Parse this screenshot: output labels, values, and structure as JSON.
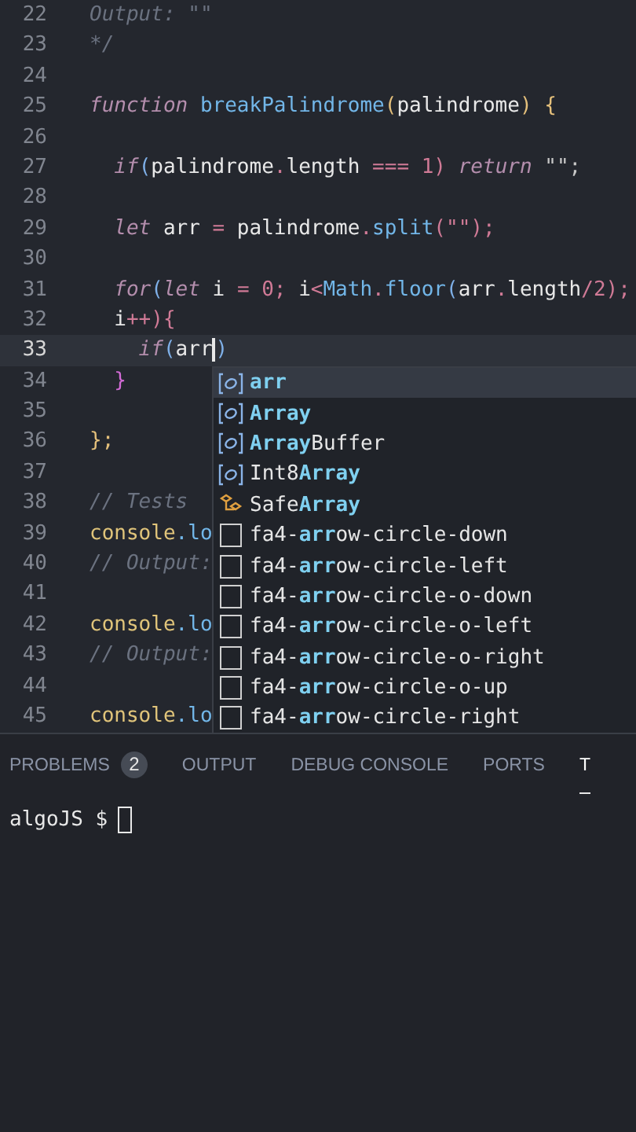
{
  "editor": {
    "lines": [
      {
        "n": "22",
        "current": false,
        "tokens": [
          {
            "t": "Output: \"\"",
            "kind": "comment"
          }
        ]
      },
      {
        "n": "23",
        "current": false,
        "tokens": [
          {
            "t": "*/",
            "kind": "comment"
          }
        ]
      },
      {
        "n": "24",
        "current": false
      },
      {
        "n": "25",
        "current": false,
        "tokens": [
          {
            "t": "function ",
            "kind": "kw"
          },
          {
            "t": "breakPalindrome",
            "kind": "fn"
          },
          {
            "t": "(",
            "kind": "brace"
          },
          {
            "t": "palindrome",
            "kind": "plain"
          },
          {
            "t": ") {",
            "kind": "brace"
          }
        ]
      },
      {
        "n": "26",
        "current": false
      },
      {
        "n": "27",
        "current": false,
        "tokens": [
          {
            "t": "  if",
            "kind": "kw"
          },
          {
            "t": "(",
            "kind": "paren"
          },
          {
            "t": "palindrome",
            "kind": "plain"
          },
          {
            "t": ".",
            "kind": "op"
          },
          {
            "t": "length ",
            "kind": "plain"
          },
          {
            "t": "=== 1)",
            "kind": "op"
          },
          {
            "t": " return",
            "kind": "kw"
          },
          {
            "t": " \"\";",
            "kind": "str"
          }
        ]
      },
      {
        "n": "28",
        "current": false
      },
      {
        "n": "29",
        "current": false,
        "tokens": [
          {
            "t": "  let",
            "kind": "kw"
          },
          {
            "t": " arr ",
            "kind": "plain"
          },
          {
            "t": "=",
            "kind": "op"
          },
          {
            "t": " palindrome",
            "kind": "plain"
          },
          {
            "t": ".",
            "kind": "op"
          },
          {
            "t": "split",
            "kind": "fn"
          },
          {
            "t": "(\"\");",
            "kind": "op"
          }
        ]
      },
      {
        "n": "30",
        "current": false
      },
      {
        "n": "31",
        "current": false,
        "tokens": [
          {
            "t": "  for",
            "kind": "kw"
          },
          {
            "t": "(",
            "kind": "paren"
          },
          {
            "t": "let",
            "kind": "kw"
          },
          {
            "t": " i ",
            "kind": "plain"
          },
          {
            "t": "= 0;",
            "kind": "op"
          },
          {
            "t": " i",
            "kind": "plain"
          },
          {
            "t": "<",
            "kind": "op"
          },
          {
            "t": "Math",
            "kind": "fn"
          },
          {
            "t": ".",
            "kind": "op"
          },
          {
            "t": "floor",
            "kind": "fn"
          },
          {
            "t": "(",
            "kind": "paren"
          },
          {
            "t": "arr",
            "kind": "plain"
          },
          {
            "t": ".",
            "kind": "op"
          },
          {
            "t": "length",
            "kind": "plain"
          },
          {
            "t": "/2);",
            "kind": "op"
          }
        ]
      },
      {
        "n": "32",
        "current": false,
        "tokens": [
          {
            "t": "  i",
            "kind": "plain"
          },
          {
            "t": "++){",
            "kind": "op"
          }
        ]
      },
      {
        "n": "33",
        "current": true,
        "tokens": [
          {
            "t": "    if",
            "kind": "kw"
          },
          {
            "t": "(",
            "kind": "paren"
          },
          {
            "t": "arr",
            "kind": "plain"
          },
          {
            "kind": "cursor"
          },
          {
            "t": ")",
            "kind": "paren"
          }
        ]
      },
      {
        "n": "34",
        "current": false,
        "tokens": [
          {
            "t": "  }",
            "kind": "brace2"
          }
        ]
      },
      {
        "n": "35",
        "current": false
      },
      {
        "n": "36",
        "current": false,
        "tokens": [
          {
            "t": "};",
            "kind": "brace"
          }
        ]
      },
      {
        "n": "37",
        "current": false
      },
      {
        "n": "38",
        "current": false,
        "tokens": [
          {
            "t": "// Tests",
            "kind": "comment"
          }
        ]
      },
      {
        "n": "39",
        "current": false,
        "tokens": [
          {
            "t": "console",
            "kind": "obj"
          },
          {
            "t": ".lo",
            "kind": "fn"
          }
        ]
      },
      {
        "n": "40",
        "current": false,
        "tokens": [
          {
            "t": "// Output:",
            "kind": "comment"
          }
        ]
      },
      {
        "n": "41",
        "current": false
      },
      {
        "n": "42",
        "current": false,
        "tokens": [
          {
            "t": "console",
            "kind": "obj"
          },
          {
            "t": ".lo",
            "kind": "fn"
          }
        ]
      },
      {
        "n": "43",
        "current": false,
        "tokens": [
          {
            "t": "// Output:",
            "kind": "comment"
          }
        ]
      },
      {
        "n": "44",
        "current": false
      },
      {
        "n": "45",
        "current": false,
        "tokens": [
          {
            "t": "console",
            "kind": "obj"
          },
          {
            "t": ".lo",
            "kind": "fn"
          }
        ]
      }
    ]
  },
  "suggestions": [
    {
      "label": "**arr**",
      "kind": "variable",
      "selected": true
    },
    {
      "label": "**Array**",
      "kind": "variable",
      "selected": false
    },
    {
      "label": "**Array**Buffer",
      "kind": "variable",
      "selected": false
    },
    {
      "label": "Int8**Array**",
      "kind": "variable",
      "selected": false
    },
    {
      "label": "Safe**Array**",
      "kind": "class",
      "selected": false
    },
    {
      "label": "fa4-**arr**ow-circle-down",
      "kind": "text",
      "selected": false
    },
    {
      "label": "fa4-**arr**ow-circle-left",
      "kind": "text",
      "selected": false
    },
    {
      "label": "fa4-**arr**ow-circle-o-down",
      "kind": "text",
      "selected": false
    },
    {
      "label": "fa4-**arr**ow-circle-o-left",
      "kind": "text",
      "selected": false
    },
    {
      "label": "fa4-**arr**ow-circle-o-right",
      "kind": "text",
      "selected": false
    },
    {
      "label": "fa4-**arr**ow-circle-o-up",
      "kind": "text",
      "selected": false
    },
    {
      "label": "fa4-**arr**ow-circle-right",
      "kind": "text",
      "selected": false
    }
  ],
  "panel": {
    "tabs": [
      {
        "label": "PROBLEMS",
        "badge": "2",
        "selected": false
      },
      {
        "label": "OUTPUT",
        "selected": false
      },
      {
        "label": "DEBUG CONSOLE",
        "selected": false
      },
      {
        "label": "PORTS",
        "selected": false
      },
      {
        "label": "T",
        "selected": true
      }
    ],
    "terminal": {
      "prompt": "algoJS $"
    }
  }
}
